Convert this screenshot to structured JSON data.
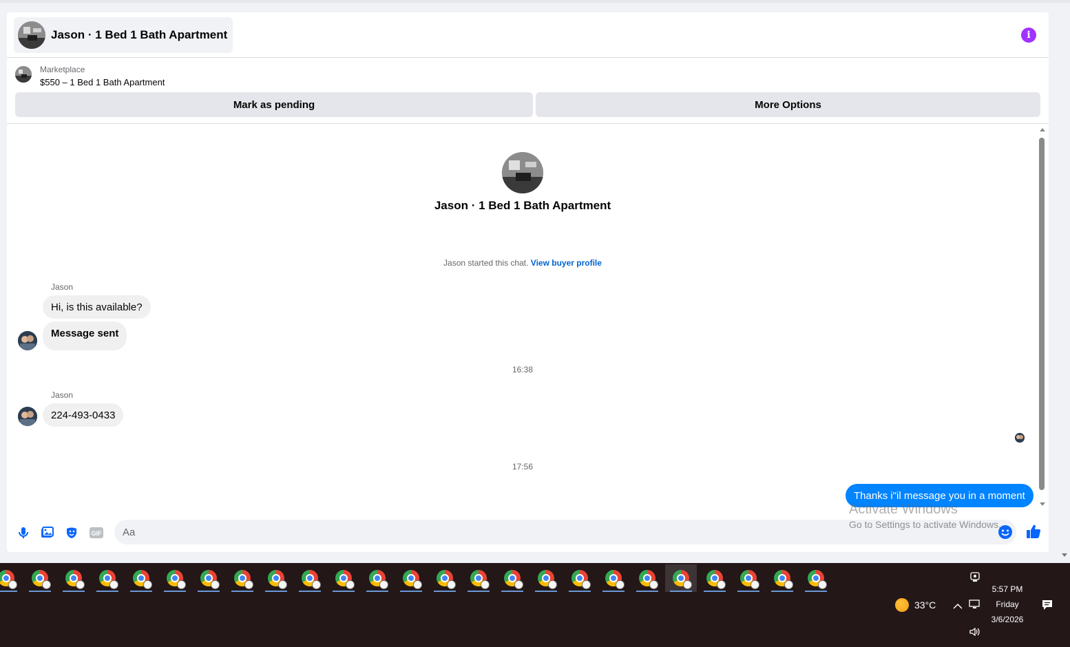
{
  "header": {
    "title": "Jason · 1 Bed 1 Bath Apartment"
  },
  "marketplace": {
    "label": "Marketplace",
    "listing": "$550 – 1 Bed 1 Bath Apartment",
    "mark_pending_label": "Mark as pending",
    "more_options_label": "More Options"
  },
  "conversation": {
    "intro_title": "Jason · 1 Bed 1 Bath Apartment",
    "started_text": "Jason started this chat.",
    "view_profile_label": "View buyer profile",
    "groups": [
      {
        "sender": "Jason",
        "messages": [
          "Hi, is this available?",
          "Message sent"
        ]
      },
      {
        "sender": "Jason",
        "messages": [
          "224-493-0433"
        ]
      }
    ],
    "timestamps": [
      "16:38",
      "17:56"
    ],
    "outgoing": [
      "Thanks i\"il message you in a moment"
    ]
  },
  "composer": {
    "placeholder": "Aa",
    "icons": [
      "microphone-icon",
      "image-icon",
      "sticker-icon",
      "gif-icon",
      "emoji-icon",
      "thumbs-up-icon"
    ],
    "gif_label": "GIF"
  },
  "watermark": {
    "line1": "Activate Windows",
    "line2": "Go to Settings to activate Windows."
  },
  "taskbar": {
    "app_count": 25,
    "active_index": 20,
    "weather": "33°C",
    "time": "5:57 PM",
    "day": "Friday",
    "date": "3/6/2026"
  },
  "colors": {
    "accent_blue": "#0084ff",
    "info_purple": "#a033ff",
    "link_blue": "#0064d1",
    "taskbar_bg": "#231718"
  }
}
